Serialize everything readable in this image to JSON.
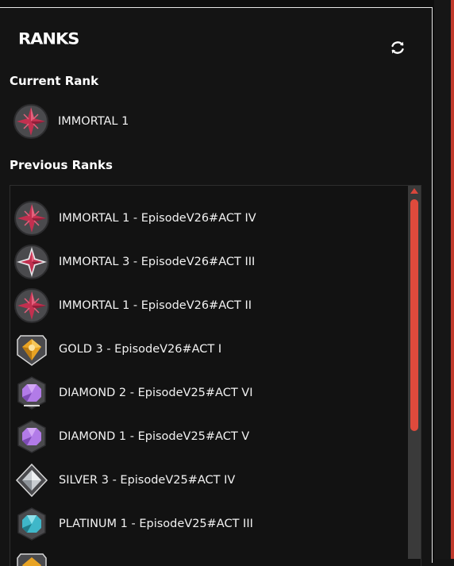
{
  "header": {
    "logo_text": "RANKS",
    "refresh_icon": "refresh-icon"
  },
  "current": {
    "title": "Current Rank",
    "rank": {
      "label": "IMMORTAL 1",
      "tier": "immortal"
    }
  },
  "previous": {
    "title": "Previous Ranks",
    "items": [
      {
        "label": "IMMORTAL 1 - EpisodeV26#ACT IV",
        "tier": "immortal"
      },
      {
        "label": "IMMORTAL 3 - EpisodeV26#ACT III",
        "tier": "immortal3"
      },
      {
        "label": "IMMORTAL 1 - EpisodeV26#ACT II",
        "tier": "immortal"
      },
      {
        "label": "GOLD 3 - EpisodeV26#ACT I",
        "tier": "gold"
      },
      {
        "label": "DIAMOND 2 - EpisodeV25#ACT VI",
        "tier": "diamond2"
      },
      {
        "label": "DIAMOND 1 - EpisodeV25#ACT V",
        "tier": "diamond1"
      },
      {
        "label": "SILVER 3 - EpisodeV25#ACT IV",
        "tier": "silver"
      },
      {
        "label": "PLATINUM 1 - EpisodeV25#ACT III",
        "tier": "platinum"
      }
    ]
  },
  "colors": {
    "background": "#141414",
    "accent": "#e04a3c",
    "immortal": "#c2304f",
    "gold": "#e8a323",
    "diamond": "#b27be8",
    "silver": "#c9cdd1",
    "platinum": "#3fb7c9"
  }
}
